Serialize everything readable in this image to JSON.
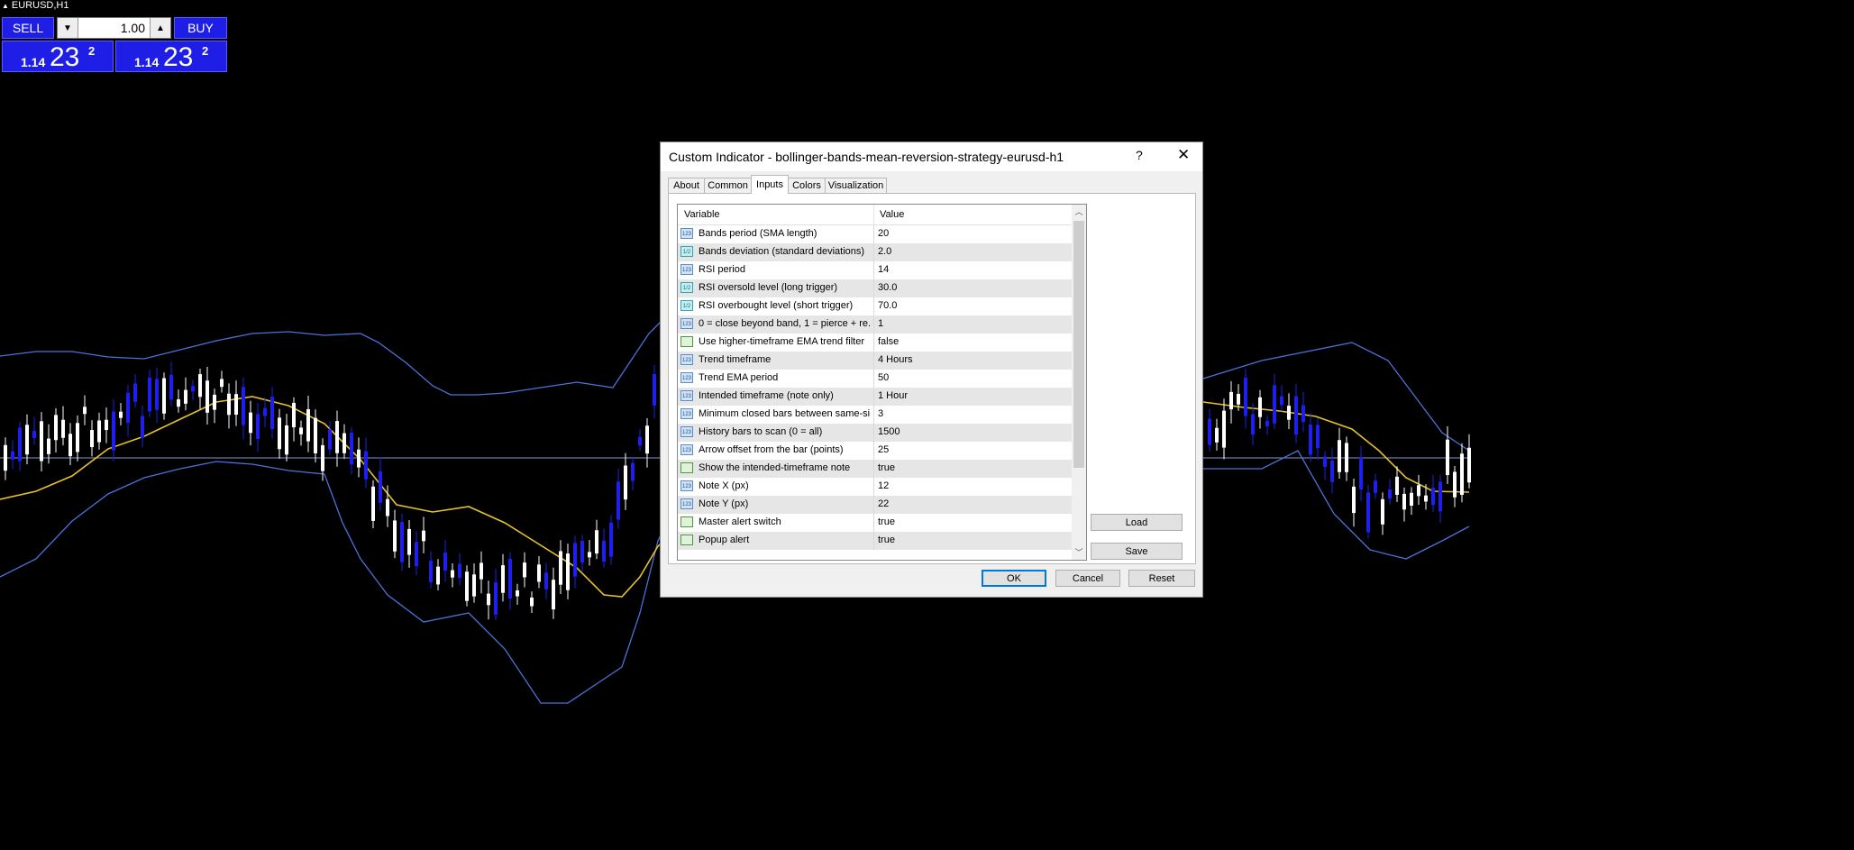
{
  "chart": {
    "symbol": "EURUSD,H1",
    "colors": {
      "background": "#000000",
      "bullish_candle": "#1e1ef0",
      "bearish_candle": "#ffffff",
      "bollinger_bands": "#4a72d8",
      "ema_line": "#e6c229",
      "price_line": "#7a9ad4"
    }
  },
  "trade_panel": {
    "sell_label": "SELL",
    "buy_label": "BUY",
    "lot_value": "1.00",
    "spin_down_icon": "triangle-down-icon",
    "spin_up_icon": "triangle-up-icon",
    "sell_price": {
      "small": "1.14",
      "big": "23",
      "sup": "2"
    },
    "buy_price": {
      "small": "1.14",
      "big": "23",
      "sup": "2"
    }
  },
  "dialog": {
    "title": "Custom Indicator - bollinger-bands-mean-reversion-strategy-eurusd-h1",
    "help_glyph": "?",
    "close_glyph": "✕",
    "tabs": [
      {
        "label": "About"
      },
      {
        "label": "Common"
      },
      {
        "label": "Inputs"
      },
      {
        "label": "Colors"
      },
      {
        "label": "Visualization"
      }
    ],
    "active_tab": "Inputs",
    "columns": {
      "variable": "Variable",
      "value": "Value"
    },
    "rows": [
      {
        "icon": "123",
        "variable": "Bands period (SMA length)",
        "value": "20"
      },
      {
        "icon": "1/2",
        "variable": "Bands deviation (standard deviations)",
        "value": "2.0"
      },
      {
        "icon": "123",
        "variable": "RSI period",
        "value": "14"
      },
      {
        "icon": "1/2",
        "variable": "RSI oversold level (long trigger)",
        "value": "30.0"
      },
      {
        "icon": "1/2",
        "variable": "RSI overbought level (short trigger)",
        "value": "70.0"
      },
      {
        "icon": "123",
        "variable": "0 = close beyond band, 1 = pierce + re...",
        "value": "1"
      },
      {
        "icon": "bool",
        "variable": "Use higher-timeframe EMA trend filter",
        "value": "false"
      },
      {
        "icon": "123",
        "variable": "Trend timeframe",
        "value": "4 Hours"
      },
      {
        "icon": "123",
        "variable": "Trend EMA period",
        "value": "50"
      },
      {
        "icon": "123",
        "variable": "Intended timeframe (note only)",
        "value": "1 Hour"
      },
      {
        "icon": "123",
        "variable": "Minimum closed bars between same-si...",
        "value": "3"
      },
      {
        "icon": "123",
        "variable": "History bars to scan (0 = all)",
        "value": "1500"
      },
      {
        "icon": "123",
        "variable": "Arrow offset from the bar (points)",
        "value": "25"
      },
      {
        "icon": "bool",
        "variable": "Show the intended-timeframe note",
        "value": "true"
      },
      {
        "icon": "123",
        "variable": "Note X (px)",
        "value": "12"
      },
      {
        "icon": "123",
        "variable": "Note Y (px)",
        "value": "22"
      },
      {
        "icon": "bool",
        "variable": "Master alert switch",
        "value": "true"
      },
      {
        "icon": "bool",
        "variable": "Popup alert",
        "value": "true"
      }
    ],
    "buttons": {
      "load": "Load",
      "save": "Save",
      "ok": "OK",
      "cancel": "Cancel",
      "reset": "Reset"
    }
  }
}
